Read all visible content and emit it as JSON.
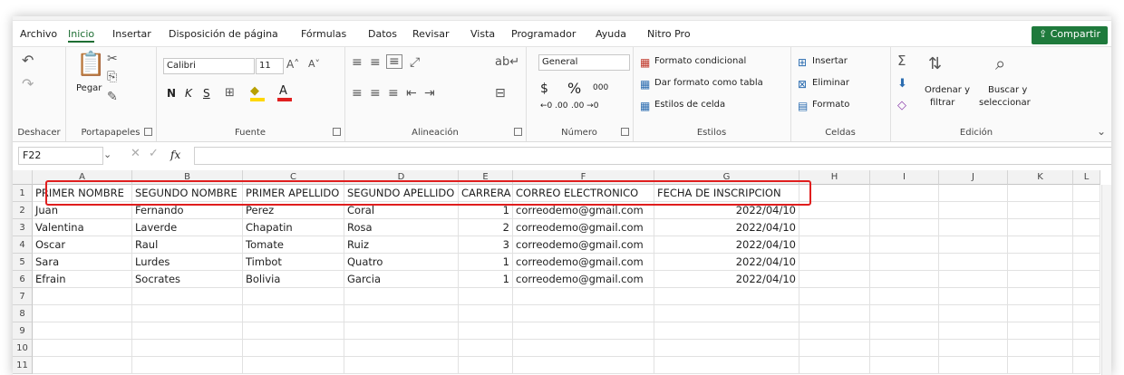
{
  "menu": {
    "items": [
      "Archivo",
      "Inicio",
      "Insertar",
      "Disposición de página",
      "Fórmulas",
      "Datos",
      "Revisar",
      "Vista",
      "Programador",
      "Ayuda",
      "Nitro Pro"
    ],
    "active": "Inicio",
    "share_label": "Compartir"
  },
  "ribbon": {
    "undo_group": {
      "label": "Deshacer"
    },
    "clipboard": {
      "label": "Portapapeles",
      "paste_label": "Pegar"
    },
    "font": {
      "label": "Fuente",
      "family": "Calibri",
      "size": "11",
      "bold": "N",
      "italic": "K",
      "underline": "S"
    },
    "alignment": {
      "label": "Alineación"
    },
    "number": {
      "label": "Número",
      "format": "General",
      "currency": "$",
      "percent": "%",
      "thousands": "000",
      "dec_inc": "←0 .00",
      "dec_dec": ".00 →0"
    },
    "styles": {
      "label": "Estilos",
      "conditional": "Formato condicional",
      "as_table": "Dar formato como tabla",
      "cell_styles": "Estilos de celda"
    },
    "cells": {
      "label": "Celdas",
      "insert": "Insertar",
      "delete": "Eliminar",
      "format": "Formato"
    },
    "editing": {
      "label": "Edición",
      "sort_line1": "Ordenar y",
      "sort_line2": "filtrar",
      "find_line1": "Buscar y",
      "find_line2": "seleccionar"
    }
  },
  "formula_bar": {
    "name_box": "F22",
    "fx": "fx",
    "value": ""
  },
  "sheet": {
    "columns": [
      "A",
      "B",
      "C",
      "D",
      "E",
      "F",
      "G",
      "H",
      "I",
      "J",
      "K",
      "L"
    ],
    "rows": [
      [
        "PRIMER NOMBRE",
        "SEGUNDO NOMBRE",
        "PRIMER APELLIDO",
        "SEGUNDO APELLIDO",
        "CARRERA",
        "CORREO ELECTRONICO",
        "FECHA DE INSCRIPCION"
      ],
      [
        "Juan",
        "Fernando",
        "Perez",
        "Coral",
        "1",
        "correodemo@gmail.com",
        "2022/04/10"
      ],
      [
        "Valentina",
        "Laverde",
        "Chapatin",
        "Rosa",
        "2",
        "correodemo@gmail.com",
        "2022/04/10"
      ],
      [
        "Oscar",
        "Raul",
        "Tomate",
        "Ruiz",
        "3",
        "correodemo@gmail.com",
        "2022/04/10"
      ],
      [
        "Sara",
        "Lurdes",
        "Timbot",
        "Quatro",
        "1",
        "correodemo@gmail.com",
        "2022/04/10"
      ],
      [
        "Efrain",
        "Socrates",
        "Bolivia",
        "Garcia",
        "1",
        "correodemo@gmail.com",
        "2022/04/10"
      ]
    ],
    "row_numbers": [
      "1",
      "2",
      "3",
      "4",
      "5",
      "6",
      "7",
      "8",
      "9",
      "10",
      "11"
    ],
    "highlight_color": "#e01e1e"
  }
}
